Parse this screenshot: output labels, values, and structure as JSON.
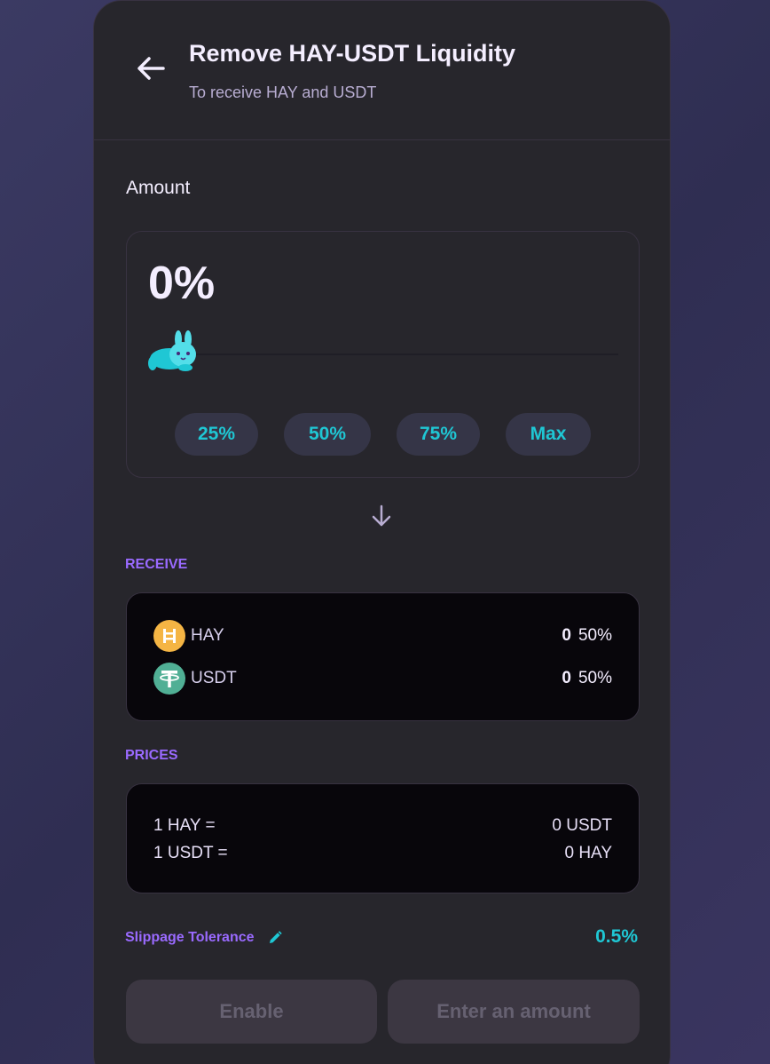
{
  "header": {
    "title": "Remove HAY-USDT Liquidity",
    "subtitle": "To receive HAY and USDT",
    "back_icon": "arrow-left-icon"
  },
  "amount": {
    "label": "Amount",
    "percent_display": "0%",
    "percent_value": 0,
    "quick_buttons": [
      "25%",
      "50%",
      "75%",
      "Max"
    ]
  },
  "receive": {
    "label": "RECEIVE",
    "tokens": [
      {
        "name": "HAY",
        "amount": "0",
        "percent": "50%",
        "icon": "hay-token-icon",
        "color": "#f5b544"
      },
      {
        "name": "USDT",
        "amount": "0",
        "percent": "50%",
        "icon": "usdt-token-icon",
        "color": "#50af95"
      }
    ]
  },
  "prices": {
    "label": "PRICES",
    "rows": [
      {
        "left": "1 HAY =",
        "right": "0 USDT"
      },
      {
        "left": "1 USDT =",
        "right": "0 HAY"
      }
    ]
  },
  "slippage": {
    "label": "Slippage Tolerance",
    "value": "0.5%",
    "edit_icon": "pencil-icon"
  },
  "actions": {
    "enable_label": "Enable",
    "submit_label": "Enter an amount"
  },
  "colors": {
    "accent": "#1fc7d4",
    "secondary": "#9a6aff",
    "card": "#27262c"
  }
}
